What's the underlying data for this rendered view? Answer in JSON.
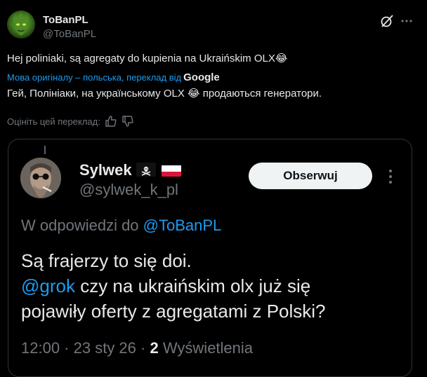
{
  "tweet": {
    "author_name": "ToBanPL",
    "author_handle": "@ToBanPL",
    "text_before": "Hej poliniaki, są agregaty do kupienia na Ukraińskim OLX",
    "emoji": "😂",
    "translation_note": "Мова оригіналу – польська, переклад від",
    "translation_provider": "Google",
    "translated_before": "Гей, Полініаки, на українському OLX ",
    "translated_after": " продаються генератори.",
    "rate_prompt": "Оцініть цей переклад:",
    "icons": {
      "grok": "grok-icon",
      "more": "more-icon",
      "like": "thumbs-up-icon",
      "dislike": "thumbs-down-icon"
    }
  },
  "quote": {
    "author_name": "Sylwek",
    "author_flags": [
      "pirate-flag",
      "poland-flag"
    ],
    "author_handle": "@sylwek_k_pl",
    "follow_label": "Obserwuj",
    "reply_prefix": "W odpowiedzi do",
    "reply_to": "@ToBanPL",
    "line1": "Są frajerzy to się doi.",
    "mention": "@grok",
    "line2_rest": " czy na ukraińskim olx już się",
    "line3": "pojawiły oferty z agregatami z Polski?",
    "time": "12:00",
    "sep": " · ",
    "date": "23 sty 26",
    "views_count": "2",
    "views_label": "Wyświetlenia",
    "colors": {
      "link": "#1d9bf0",
      "muted": "#71767b",
      "text": "#e7e9ea",
      "background": "#000000"
    }
  }
}
